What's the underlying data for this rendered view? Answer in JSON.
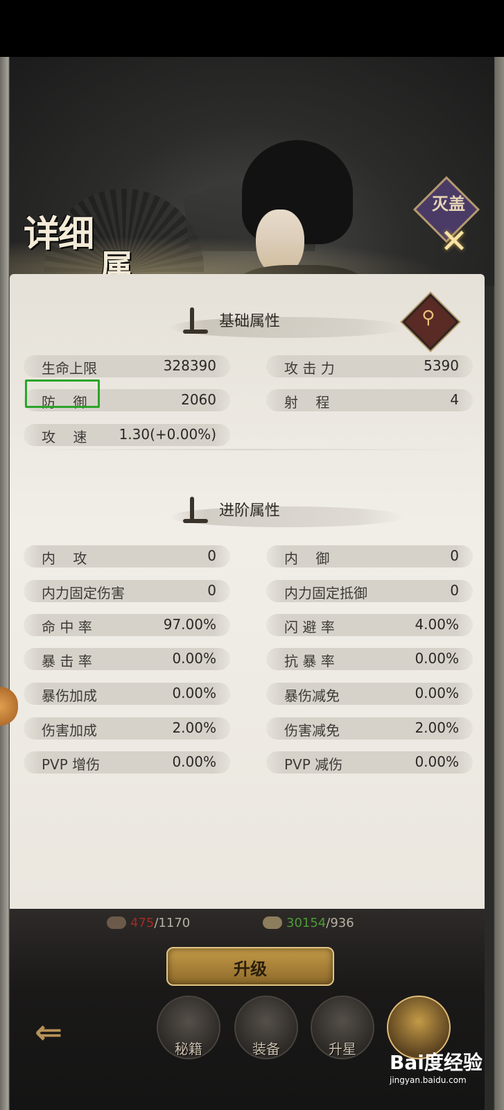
{
  "title": "详细属性",
  "title_line1": "详细",
  "title_line2": "属性",
  "close_emblem_text": "灭盖",
  "close_glyph": "✕",
  "basic": {
    "heading": "基础属性",
    "search_glyph": "⚲",
    "stats": [
      {
        "name": "生命上限",
        "value": "328390"
      },
      {
        "name": "攻 击 力",
        "value": "5390"
      },
      {
        "name": "防    御",
        "value": "2060"
      },
      {
        "name": "射    程",
        "value": "4"
      },
      {
        "name": "攻    速",
        "value": "1.30(+0.00%)"
      }
    ]
  },
  "advanced": {
    "heading": "进阶属性",
    "stats": [
      {
        "name": "内    攻",
        "value": "0"
      },
      {
        "name": "内    御",
        "value": "0"
      },
      {
        "name": "内力固定伤害",
        "value": "0"
      },
      {
        "name": "内力固定抵御",
        "value": "0"
      },
      {
        "name": "命 中 率",
        "value": "97.00%"
      },
      {
        "name": "闪 避 率",
        "value": "4.00%"
      },
      {
        "name": "暴 击 率",
        "value": "0.00%"
      },
      {
        "name": "抗 暴 率",
        "value": "0.00%"
      },
      {
        "name": "暴伤加成",
        "value": "0.00%"
      },
      {
        "name": "暴伤减免",
        "value": "0.00%"
      },
      {
        "name": "伤害加成",
        "value": "2.00%"
      },
      {
        "name": "伤害减免",
        "value": "2.00%"
      },
      {
        "name": "PVP 增伤",
        "value": "0.00%"
      },
      {
        "name": "PVP 减伤",
        "value": "0.00%"
      }
    ]
  },
  "resources": {
    "r1_current": "475",
    "r1_total": "/1170",
    "r2_current": "30154",
    "r2_total": "/936"
  },
  "colors": {
    "r1_current": "#a32a22",
    "r2_current": "#4f9a38",
    "totals": "#b8b0a2",
    "highlight": "#2aa52a"
  },
  "upgrade_label": "升级",
  "back_glyph": "⇐",
  "nav": {
    "items": [
      {
        "label": "秘籍"
      },
      {
        "label": "装备"
      },
      {
        "label": "升星"
      },
      {
        "label": ""
      }
    ]
  },
  "watermark": {
    "brand": "Bai度经验",
    "url": "jingyan.baidu.com"
  }
}
